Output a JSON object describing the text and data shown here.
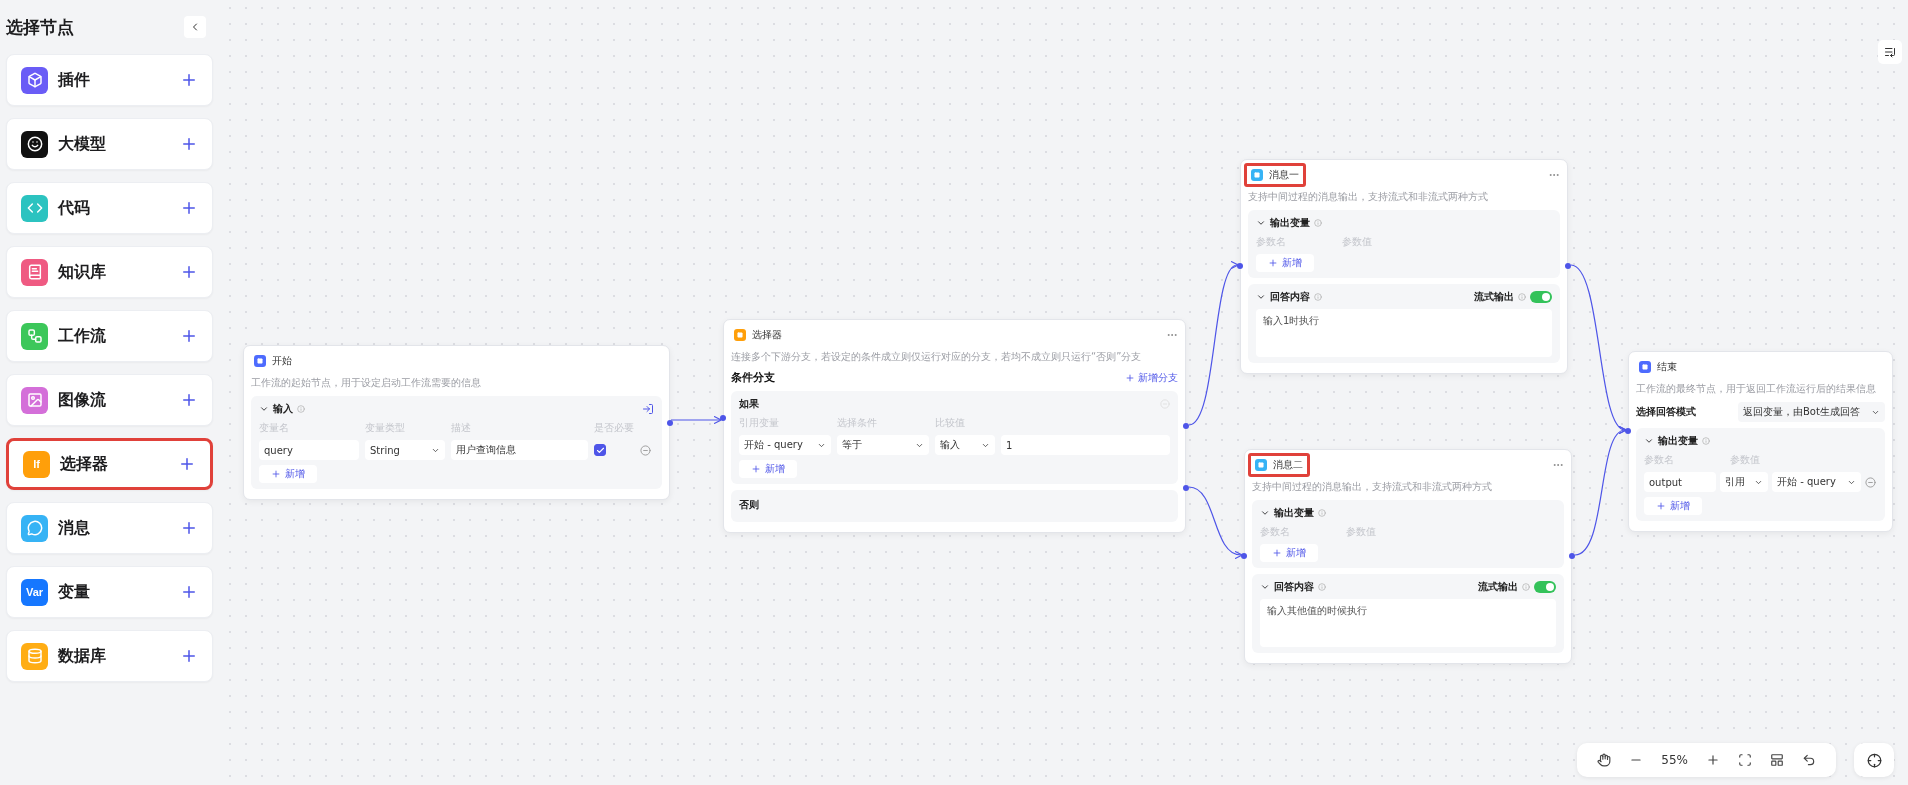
{
  "sidebar": {
    "title": "选择节点",
    "items": [
      {
        "label": "插件",
        "kind": "plugin",
        "color": "#6a5cf6",
        "highlighted": false
      },
      {
        "label": "大模型",
        "kind": "model",
        "color": "#111111",
        "highlighted": false
      },
      {
        "label": "代码",
        "kind": "code",
        "color": "#2cc3c0",
        "highlighted": false
      },
      {
        "label": "知识库",
        "kind": "book",
        "color": "#ef5a82",
        "highlighted": false
      },
      {
        "label": "工作流",
        "kind": "flow",
        "color": "#3cc75a",
        "highlighted": false
      },
      {
        "label": "图像流",
        "kind": "image",
        "color": "#d46fd9",
        "highlighted": false
      },
      {
        "label": "选择器",
        "kind": "text",
        "icon_text": "If",
        "color": "#ff9f0a",
        "highlighted": true
      },
      {
        "label": "消息",
        "kind": "chat",
        "color": "#36b3f5",
        "highlighted": false
      },
      {
        "label": "变量",
        "kind": "text",
        "icon_text": "Var",
        "color": "#1677ff",
        "highlighted": false
      },
      {
        "label": "数据库",
        "kind": "db",
        "color": "#ffad14",
        "highlighted": false
      }
    ]
  },
  "nodes": [
    {
      "kind": "start",
      "title": "开始",
      "color": "#4d6bfe",
      "highlighted": false,
      "description": "工作流的起始节点，用于设定启动工作流需要的信息",
      "section": {
        "title": "输入",
        "expanded": true
      },
      "columns": [
        "变量名",
        "变量类型",
        "描述",
        "是否必要"
      ],
      "rows": [
        {
          "name": "query",
          "type": "String",
          "description": "用户查询信息",
          "required": true
        }
      ],
      "add_label": "新增"
    },
    {
      "kind": "selector",
      "title": "选择器",
      "color": "#ff9f0a",
      "highlighted": false,
      "description": "连接多个下游分支，若设定的条件成立则仅运行对应的分支，若均不成立则只运行“否则”分支",
      "branch_title": "条件分支",
      "add_branch": "新增分支",
      "if_label": "如果",
      "columns": [
        "引用变量",
        "选择条件",
        "比较值"
      ],
      "condition": {
        "variable": "开始 - query",
        "operator": "等于",
        "value_type": "输入",
        "value": "1"
      },
      "add_label": "新增",
      "else_label": "否则"
    },
    {
      "kind": "message",
      "title": "消息一",
      "color": "#36b3f5",
      "highlighted": true,
      "description": "支持中间过程的消息输出，支持流式和非流式两种方式",
      "output_section": {
        "title": "输出变量",
        "expanded": true
      },
      "columns": [
        "参数名",
        "参数值"
      ],
      "add_label": "新增",
      "answer_section": {
        "title": "回答内容",
        "expanded": true
      },
      "stream_label": "流式输出",
      "stream_on": true,
      "answer": "输入1时执行"
    },
    {
      "kind": "message",
      "title": "消息二",
      "color": "#36b3f5",
      "highlighted": true,
      "description": "支持中间过程的消息输出，支持流式和非流式两种方式",
      "output_section": {
        "title": "输出变量",
        "expanded": true
      },
      "columns": [
        "参数名",
        "参数值"
      ],
      "add_label": "新增",
      "answer_section": {
        "title": "回答内容",
        "expanded": true
      },
      "stream_label": "流式输出",
      "stream_on": true,
      "answer": "输入其他值的时候执行"
    },
    {
      "kind": "end",
      "title": "结束",
      "color": "#4d6bfe",
      "highlighted": false,
      "description": "工作流的最终节点，用于返回工作流运行后的结果信息",
      "mode_label": "选择回答模式",
      "mode": "返回变量，由Bot生成回答",
      "output_section": {
        "title": "输出变量",
        "expanded": true
      },
      "columns": [
        "参数名",
        "参数值"
      ],
      "rows": [
        {
          "name": "output",
          "source": "引用",
          "value": "开始 - query"
        }
      ],
      "add_label": "新增"
    }
  ],
  "toolbar": {
    "zoom": "55%"
  }
}
